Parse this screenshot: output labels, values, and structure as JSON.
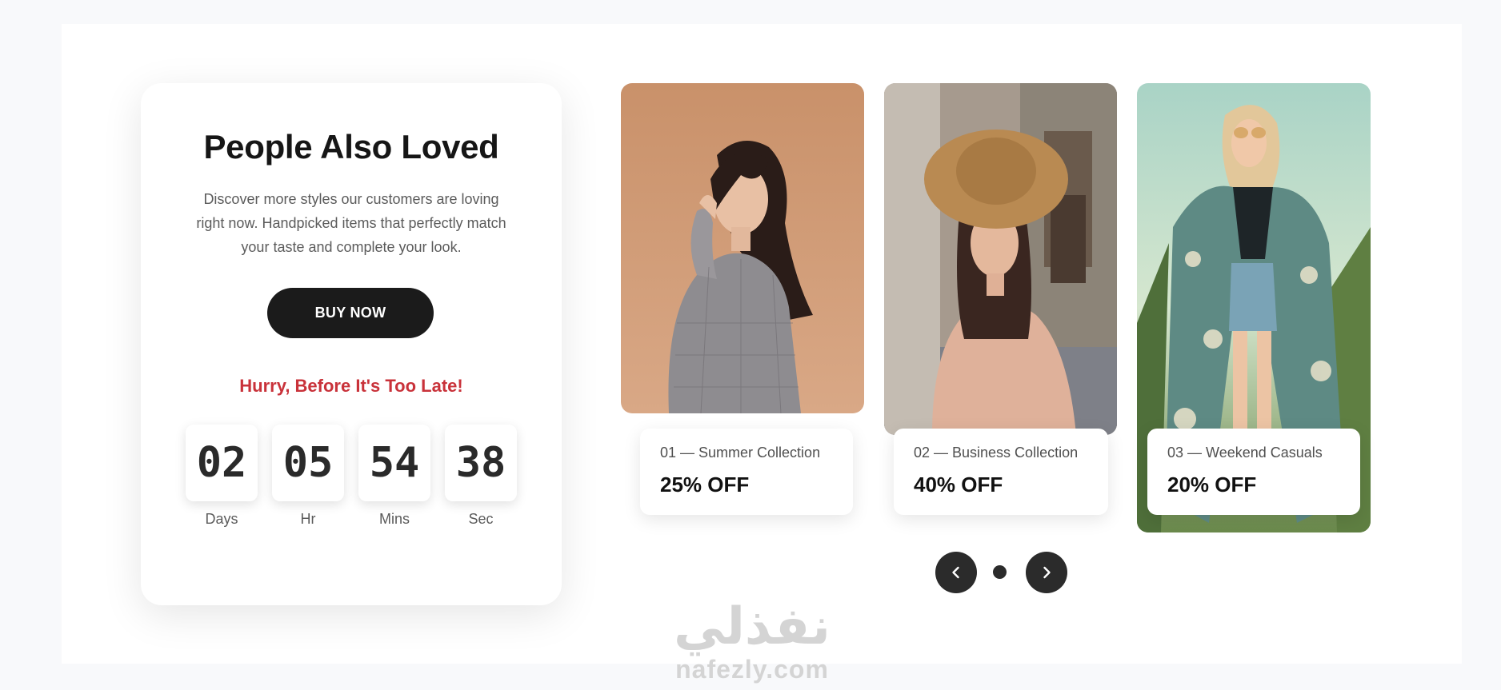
{
  "promo": {
    "title": "People Also Loved",
    "description": "Discover more styles our customers are loving right now. Handpicked items that perfectly match your taste and complete your look.",
    "buy_label": "BUY NOW",
    "hurry_text": "Hurry, Before It's Too Late!",
    "countdown": [
      {
        "value": "02",
        "label": "Days"
      },
      {
        "value": "05",
        "label": "Hr"
      },
      {
        "value": "54",
        "label": "Mins"
      },
      {
        "value": "38",
        "label": "Sec"
      }
    ]
  },
  "products": [
    {
      "subtitle": "01 — Summer Collection",
      "discount": "25% OFF"
    },
    {
      "subtitle": "02 — Business Collection",
      "discount": "40% OFF"
    },
    {
      "subtitle": "03 — Weekend Casuals",
      "discount": "20% OFF"
    }
  ],
  "carousel": {
    "prev_icon": "chevron-left-icon",
    "next_icon": "chevron-right-icon",
    "pages": 1,
    "current_page": 1
  },
  "watermark": {
    "arabic": "نفذلي",
    "latin": "nafezly.com"
  },
  "colors": {
    "dark": "#1b1b1b",
    "accent_red": "#c9323a",
    "background": "#f8f9fb"
  }
}
